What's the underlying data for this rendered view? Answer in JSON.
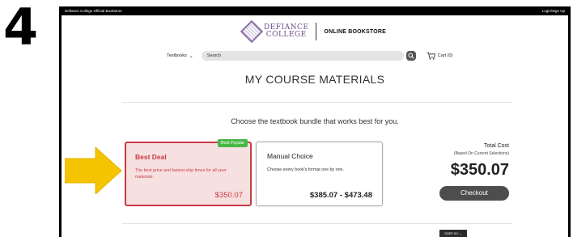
{
  "step": {
    "number": "4"
  },
  "topbar": {
    "left_text": "Defiance College Official Bookstore",
    "right_text": "Login/Sign Up"
  },
  "brand": {
    "logo_line1": "DEFIANCE",
    "logo_line2": "COLLEGE",
    "store_name": "ONLINE BOOKSTORE",
    "logo_color": "#6b4f8a"
  },
  "nav": {
    "textbooks_label": "Textbooks",
    "search_placeholder": "Search",
    "cart_label": "Cart (0)"
  },
  "page": {
    "title": "MY COURSE MATERIALS",
    "choose_prompt": "Choose the textbook bundle that works best for you."
  },
  "bundles": [
    {
      "badge": "Most Popular",
      "title": "Best Deal",
      "description": "The best price and fastest ship times for all your materials.",
      "price": "$350.07",
      "selected": true
    },
    {
      "title": "Manual Choice",
      "description": "Choose every book's format one by one.",
      "price": "$385.07 - $473.48",
      "selected": false
    }
  ],
  "total": {
    "label": "Total Cost",
    "sublabel": "(Based On Current Selections)",
    "value": "$350.07",
    "checkout_label": "Checkout"
  },
  "sort": {
    "label": "SORT BY"
  },
  "colors": {
    "accent_red": "#c83a45",
    "badge_green": "#47b847",
    "arrow_yellow": "#f5c400",
    "checkout_gray": "#4d4d4d"
  },
  "icons": {
    "search": "search-icon",
    "cart": "cart-icon",
    "chevron": "chevron-down-icon",
    "arrow": "arrow-right-icon"
  }
}
